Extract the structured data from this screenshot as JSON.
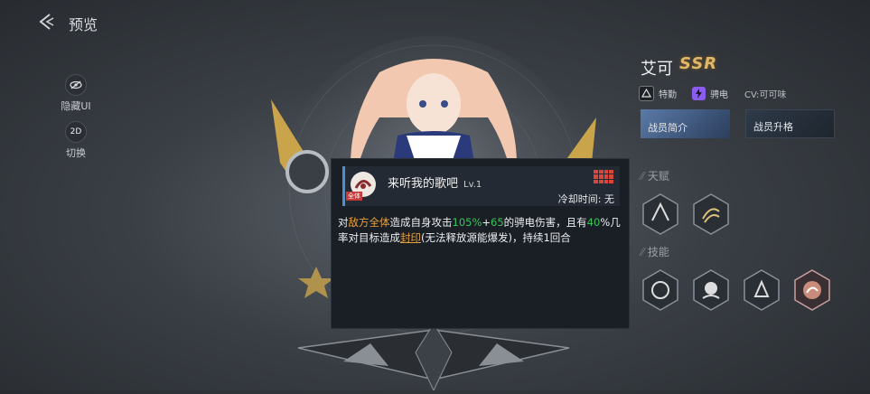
{
  "header": {
    "title": "预览"
  },
  "side": {
    "hide_ui": "隐藏UI",
    "switch_badge": "2D",
    "switch": "切换"
  },
  "character": {
    "name": "艾可",
    "rarity": "SSR",
    "class_label": "特勤",
    "element_label": "骋电",
    "cv": "CV:可可味"
  },
  "buttons": {
    "intro": "战员简介",
    "upgrade": "战员升格"
  },
  "sections": {
    "talent": "天赋",
    "skills": "技能"
  },
  "tooltip": {
    "skill_name": "来听我的歌吧",
    "level": "Lv.1",
    "target_badge": "全体",
    "cooldown": "冷却时间: 无",
    "desc": {
      "p1": "对",
      "target": "敌方全体",
      "p2": "造成自身攻击",
      "v1": "105%",
      "p3": "+",
      "v2": "65",
      "p4": "的骋电伤害，且有",
      "v3": "40",
      "p5": "%几率对目标造成",
      "status": "封印",
      "p6": "(无法释放源能爆发)，持续1回合"
    }
  },
  "colors": {
    "accent_blue": "#4a8fd8",
    "highlight_orange": "#e8a13a",
    "highlight_green": "#39c55a",
    "rarity_gold": "#e0b66a",
    "element_purple": "#8a5cf0"
  },
  "icons": [
    "back-arrow-icon",
    "eye-hide-icon",
    "class-icon",
    "lightning-icon",
    "talent-icon-1",
    "talent-icon-2",
    "skill-icon-1",
    "skill-icon-2",
    "skill-icon-3",
    "skill-icon-4",
    "grid-icon"
  ]
}
